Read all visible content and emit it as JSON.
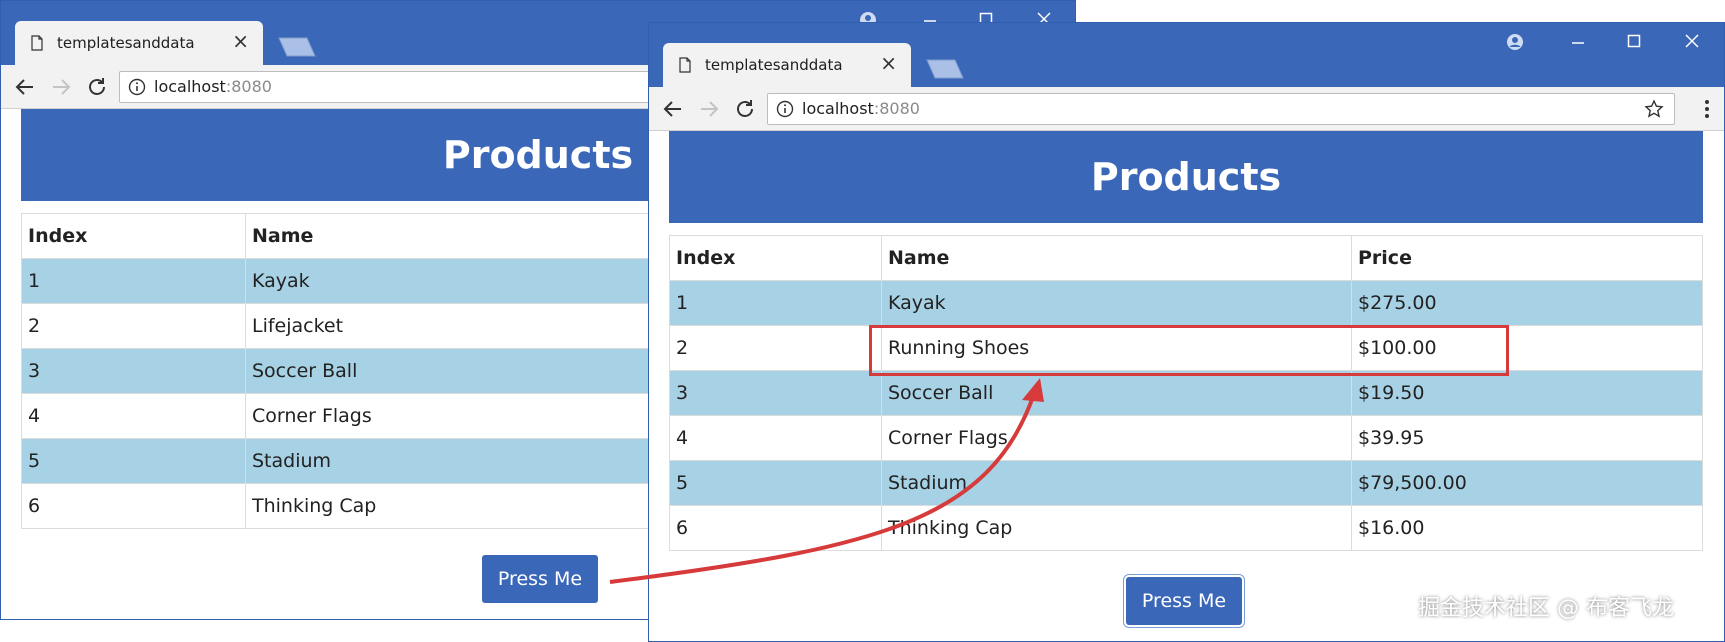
{
  "browser": {
    "tab_title": "templatesanddata",
    "tab_close": "×",
    "url_host": "localhost",
    "url_port": ":8080",
    "accent_color": "#3a67b8"
  },
  "page": {
    "title": "Products",
    "button_label": "Press Me"
  },
  "table_a": {
    "headers": [
      "Index",
      "Name"
    ],
    "rows": [
      [
        "1",
        "Kayak"
      ],
      [
        "2",
        "Lifejacket"
      ],
      [
        "3",
        "Soccer Ball"
      ],
      [
        "4",
        "Corner Flags"
      ],
      [
        "5",
        "Stadium"
      ],
      [
        "6",
        "Thinking Cap"
      ]
    ]
  },
  "table_b": {
    "headers": [
      "Index",
      "Name",
      "Price"
    ],
    "rows": [
      [
        "1",
        "Kayak",
        "$275.00"
      ],
      [
        "2",
        "Running Shoes",
        "$100.00"
      ],
      [
        "3",
        "Soccer Ball",
        "$19.50"
      ],
      [
        "4",
        "Corner Flags",
        "$39.95"
      ],
      [
        "5",
        "Stadium",
        "$79,500.00"
      ],
      [
        "6",
        "Thinking Cap",
        "$16.00"
      ]
    ]
  },
  "annotation": {
    "color": "#d63a3a"
  },
  "watermark": "掘金技术社区 @ 布客飞龙"
}
